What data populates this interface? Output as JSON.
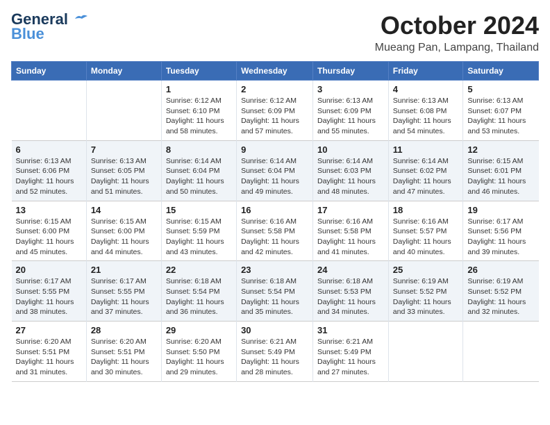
{
  "header": {
    "logo_line1": "General",
    "logo_line2": "Blue",
    "month": "October 2024",
    "location": "Mueang Pan, Lampang, Thailand"
  },
  "weekdays": [
    "Sunday",
    "Monday",
    "Tuesday",
    "Wednesday",
    "Thursday",
    "Friday",
    "Saturday"
  ],
  "weeks": [
    [
      {
        "day": "",
        "info": ""
      },
      {
        "day": "",
        "info": ""
      },
      {
        "day": "1",
        "info": "Sunrise: 6:12 AM\nSunset: 6:10 PM\nDaylight: 11 hours and 58 minutes."
      },
      {
        "day": "2",
        "info": "Sunrise: 6:12 AM\nSunset: 6:09 PM\nDaylight: 11 hours and 57 minutes."
      },
      {
        "day": "3",
        "info": "Sunrise: 6:13 AM\nSunset: 6:09 PM\nDaylight: 11 hours and 55 minutes."
      },
      {
        "day": "4",
        "info": "Sunrise: 6:13 AM\nSunset: 6:08 PM\nDaylight: 11 hours and 54 minutes."
      },
      {
        "day": "5",
        "info": "Sunrise: 6:13 AM\nSunset: 6:07 PM\nDaylight: 11 hours and 53 minutes."
      }
    ],
    [
      {
        "day": "6",
        "info": "Sunrise: 6:13 AM\nSunset: 6:06 PM\nDaylight: 11 hours and 52 minutes."
      },
      {
        "day": "7",
        "info": "Sunrise: 6:13 AM\nSunset: 6:05 PM\nDaylight: 11 hours and 51 minutes."
      },
      {
        "day": "8",
        "info": "Sunrise: 6:14 AM\nSunset: 6:04 PM\nDaylight: 11 hours and 50 minutes."
      },
      {
        "day": "9",
        "info": "Sunrise: 6:14 AM\nSunset: 6:04 PM\nDaylight: 11 hours and 49 minutes."
      },
      {
        "day": "10",
        "info": "Sunrise: 6:14 AM\nSunset: 6:03 PM\nDaylight: 11 hours and 48 minutes."
      },
      {
        "day": "11",
        "info": "Sunrise: 6:14 AM\nSunset: 6:02 PM\nDaylight: 11 hours and 47 minutes."
      },
      {
        "day": "12",
        "info": "Sunrise: 6:15 AM\nSunset: 6:01 PM\nDaylight: 11 hours and 46 minutes."
      }
    ],
    [
      {
        "day": "13",
        "info": "Sunrise: 6:15 AM\nSunset: 6:00 PM\nDaylight: 11 hours and 45 minutes."
      },
      {
        "day": "14",
        "info": "Sunrise: 6:15 AM\nSunset: 6:00 PM\nDaylight: 11 hours and 44 minutes."
      },
      {
        "day": "15",
        "info": "Sunrise: 6:15 AM\nSunset: 5:59 PM\nDaylight: 11 hours and 43 minutes."
      },
      {
        "day": "16",
        "info": "Sunrise: 6:16 AM\nSunset: 5:58 PM\nDaylight: 11 hours and 42 minutes."
      },
      {
        "day": "17",
        "info": "Sunrise: 6:16 AM\nSunset: 5:58 PM\nDaylight: 11 hours and 41 minutes."
      },
      {
        "day": "18",
        "info": "Sunrise: 6:16 AM\nSunset: 5:57 PM\nDaylight: 11 hours and 40 minutes."
      },
      {
        "day": "19",
        "info": "Sunrise: 6:17 AM\nSunset: 5:56 PM\nDaylight: 11 hours and 39 minutes."
      }
    ],
    [
      {
        "day": "20",
        "info": "Sunrise: 6:17 AM\nSunset: 5:55 PM\nDaylight: 11 hours and 38 minutes."
      },
      {
        "day": "21",
        "info": "Sunrise: 6:17 AM\nSunset: 5:55 PM\nDaylight: 11 hours and 37 minutes."
      },
      {
        "day": "22",
        "info": "Sunrise: 6:18 AM\nSunset: 5:54 PM\nDaylight: 11 hours and 36 minutes."
      },
      {
        "day": "23",
        "info": "Sunrise: 6:18 AM\nSunset: 5:54 PM\nDaylight: 11 hours and 35 minutes."
      },
      {
        "day": "24",
        "info": "Sunrise: 6:18 AM\nSunset: 5:53 PM\nDaylight: 11 hours and 34 minutes."
      },
      {
        "day": "25",
        "info": "Sunrise: 6:19 AM\nSunset: 5:52 PM\nDaylight: 11 hours and 33 minutes."
      },
      {
        "day": "26",
        "info": "Sunrise: 6:19 AM\nSunset: 5:52 PM\nDaylight: 11 hours and 32 minutes."
      }
    ],
    [
      {
        "day": "27",
        "info": "Sunrise: 6:20 AM\nSunset: 5:51 PM\nDaylight: 11 hours and 31 minutes."
      },
      {
        "day": "28",
        "info": "Sunrise: 6:20 AM\nSunset: 5:51 PM\nDaylight: 11 hours and 30 minutes."
      },
      {
        "day": "29",
        "info": "Sunrise: 6:20 AM\nSunset: 5:50 PM\nDaylight: 11 hours and 29 minutes."
      },
      {
        "day": "30",
        "info": "Sunrise: 6:21 AM\nSunset: 5:49 PM\nDaylight: 11 hours and 28 minutes."
      },
      {
        "day": "31",
        "info": "Sunrise: 6:21 AM\nSunset: 5:49 PM\nDaylight: 11 hours and 27 minutes."
      },
      {
        "day": "",
        "info": ""
      },
      {
        "day": "",
        "info": ""
      }
    ]
  ]
}
